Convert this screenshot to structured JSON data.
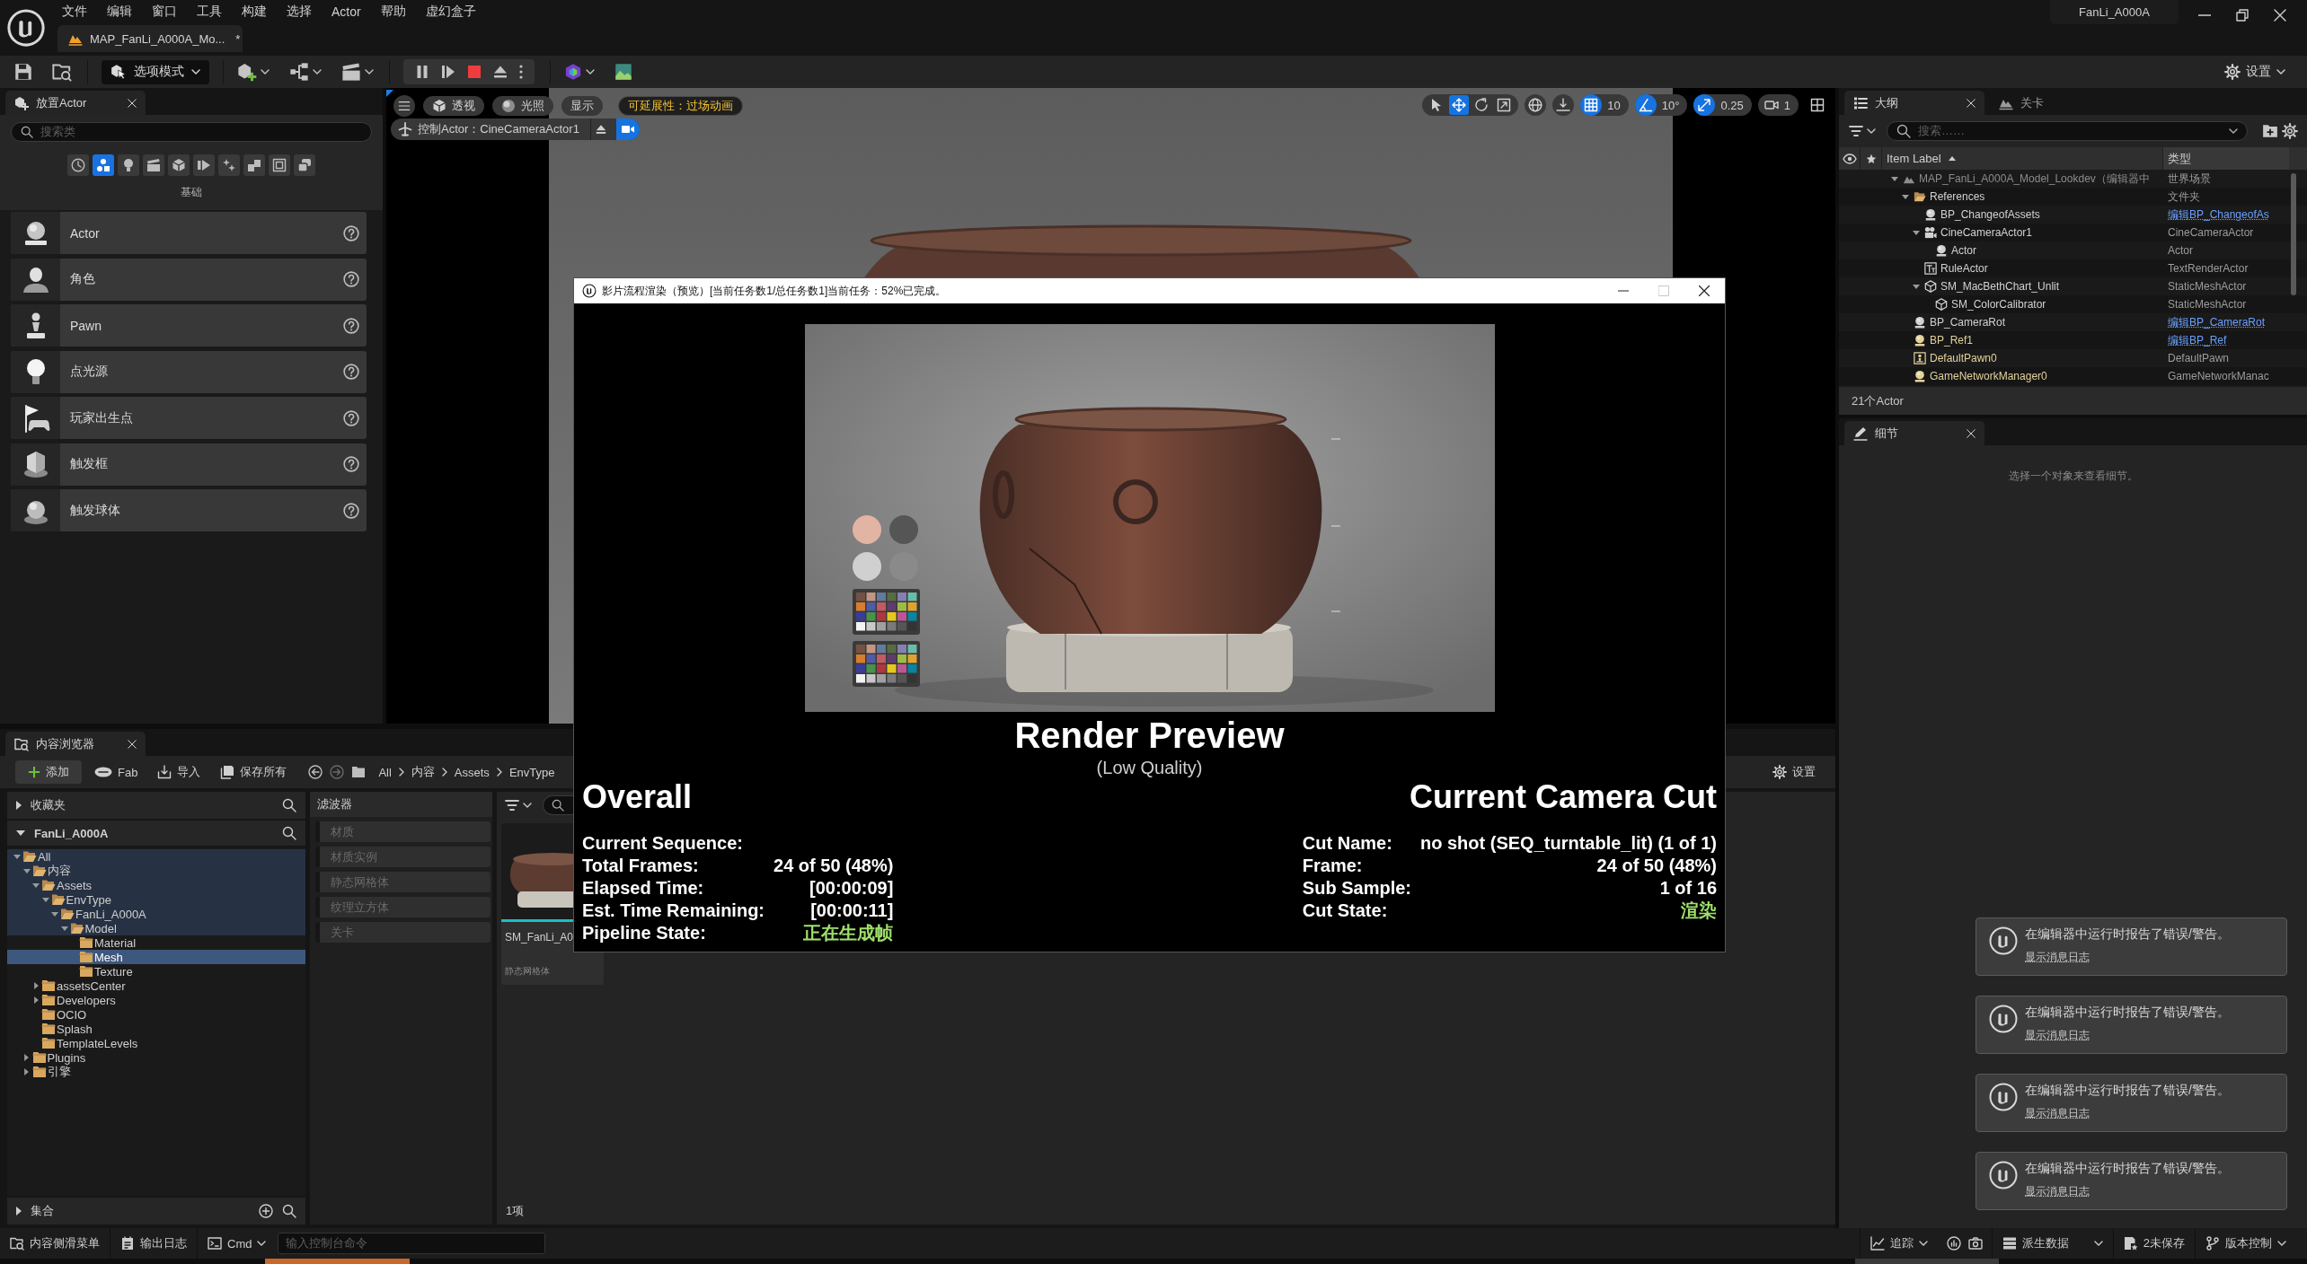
{
  "title_bar": {
    "menu": [
      "文件",
      "编辑",
      "窗口",
      "工具",
      "构建",
      "选择",
      "Actor",
      "帮助",
      "虚幻盒子"
    ],
    "document_tab": {
      "title": "MAP_FanLi_A000A_Mo...",
      "modified": "*"
    },
    "project": "FanLi_A000A"
  },
  "toolbar": {
    "mode": "选项模式",
    "settings": "设置"
  },
  "place_actors": {
    "tab": "放置Actor",
    "search": {
      "placeholder": "搜索类"
    },
    "categories": [
      {
        "kind": "recent",
        "selected": false
      },
      {
        "kind": "basic",
        "selected": true
      },
      {
        "kind": "lights",
        "selected": false
      },
      {
        "kind": "cinematic",
        "selected": false
      },
      {
        "kind": "visual",
        "selected": false
      },
      {
        "kind": "volumes",
        "selected": false
      },
      {
        "kind": "effects",
        "selected": false
      },
      {
        "kind": "shapes",
        "selected": false
      },
      {
        "kind": "frame",
        "selected": false
      },
      {
        "kind": "stack",
        "selected": false
      }
    ],
    "category_title": "基础",
    "items": [
      {
        "label": "Actor",
        "kind": "actor"
      },
      {
        "label": "角色",
        "kind": "character"
      },
      {
        "label": "Pawn",
        "kind": "pawn"
      },
      {
        "label": "点光源",
        "kind": "light"
      },
      {
        "label": "玩家出生点",
        "kind": "start"
      },
      {
        "label": "触发框",
        "kind": "box"
      },
      {
        "label": "触发球体",
        "kind": "sphere"
      }
    ]
  },
  "viewport": {
    "view_mode": "透视",
    "lighting": "光照",
    "show": "显示",
    "scalability": "可延展性：过场动画",
    "pilot": "控制Actor：CineCameraActor1",
    "camera_view": true,
    "transform_tools": [
      {
        "kind": "select",
        "selected": false
      },
      {
        "kind": "move",
        "selected": true
      },
      {
        "kind": "rotate",
        "selected": false
      },
      {
        "kind": "scale",
        "selected": false
      }
    ],
    "snaps": [
      {
        "kind": "grid",
        "value": "10",
        "on": true
      },
      {
        "kind": "angle",
        "value": "10°",
        "on": true
      },
      {
        "kind": "scale",
        "value": "0.25",
        "on": true
      }
    ],
    "camera_speed": "1"
  },
  "render_dialog": {
    "title": "影片流程渲染（预览）[当前任务数1/总任务数1]当前任务：52%已完成。",
    "heading": "Render Preview",
    "subheading": "(Low Quality)",
    "overall": {
      "title": "Overall",
      "stats": [
        {
          "label": "Current Sequence:"
        },
        {
          "label": "Total Frames:",
          "value": "24 of 50 (48%)",
          "color": "#ffffff"
        },
        {
          "label": "Elapsed Time:",
          "value": "[00:00:09]",
          "color": "#ffffff"
        },
        {
          "label": "Est. Time Remaining:",
          "value": "[00:00:11]",
          "color": "#ffffff"
        },
        {
          "label": "Pipeline State:",
          "value": "正在生成帧",
          "color": "#9fe06a"
        }
      ]
    },
    "camera_cut": {
      "title": "Current Camera Cut",
      "stats": [
        {
          "label": "Cut Name:",
          "value": "no shot (SEQ_turntable_lit) (1 of 1)",
          "color": "#ffffff"
        },
        {
          "label": "Frame:",
          "value": "24 of 50 (48%)",
          "color": "#ffffff"
        },
        {
          "label": "Sub Sample:",
          "value": "1 of 16",
          "color": "#ffffff"
        },
        {
          "label": "Cut State:",
          "value": "渲染",
          "color": "#9fe06a"
        }
      ]
    }
  },
  "outliner": {
    "tabs": [
      {
        "label": "大纲",
        "selected": true
      },
      {
        "label": "关卡",
        "selected": false
      }
    ],
    "search": {
      "placeholder": "搜索……"
    },
    "columns": [
      "Item Label",
      "类型"
    ],
    "rows": [
      {
        "label": "MAP_FanLi_A000A_Model_Lookdev（编辑器中",
        "kind": "world",
        "color": "#8c8c8c",
        "type": "世界场景",
        "type_link": false,
        "expanded": true,
        "children": [
          {
            "label": "References",
            "kind": "folder",
            "color": "#d2d2d2",
            "type": "文件夹",
            "type_link": false,
            "expanded": true,
            "children": [
              {
                "label": "BP_ChangeofAssets",
                "kind": "actor",
                "color": "#d2d2d2",
                "type": "编辑BP_ChangeofAs",
                "type_link": true
              },
              {
                "label": "CineCameraActor1",
                "kind": "camera",
                "color": "#d2d2d2",
                "type": "CineCameraActor",
                "type_link": false,
                "expanded": true,
                "children": [
                  {
                    "label": "Actor",
                    "kind": "actor",
                    "color": "#d2d2d2",
                    "type": "Actor",
                    "type_link": false
                  }
                ]
              },
              {
                "label": "RuleActor",
                "kind": "text",
                "color": "#d2d2d2",
                "type": "TextRenderActor",
                "type_link": false
              },
              {
                "label": "SM_MacBethChart_Unlit",
                "kind": "mesh",
                "color": "#d2d2d2",
                "type": "StaticMeshActor",
                "type_link": false,
                "expanded": true,
                "children": [
                  {
                    "label": "SM_ColorCalibrator",
                    "kind": "mesh",
                    "color": "#d2d2d2",
                    "type": "StaticMeshActor",
                    "type_link": false
                  }
                ]
              }
            ]
          },
          {
            "label": "BP_CameraRot",
            "kind": "actor",
            "color": "#d2d2d2",
            "type": "编辑BP_CameraRot",
            "type_link": true
          },
          {
            "label": "BP_Ref1",
            "kind": "actor",
            "color": "#e3d29c",
            "type": "编辑BP_Ref",
            "type_link": true
          },
          {
            "label": "DefaultPawn0",
            "kind": "pawn",
            "color": "#e3d29c",
            "type": "DefaultPawn",
            "type_link": false
          },
          {
            "label": "GameNetworkManager0",
            "kind": "actor",
            "color": "#e3d29c",
            "type": "GameNetworkManac",
            "type_link": false
          }
        ]
      }
    ],
    "footer": "21个Actor"
  },
  "details": {
    "tab": "细节",
    "message": "选择一个对象来查看细节。"
  },
  "content_browser": {
    "tab": "内容浏览器",
    "add": "添加",
    "fab": "Fab",
    "import": "导入",
    "save_all": "保存所有",
    "breadcrumb": [
      "All",
      "内容",
      "Assets",
      "EnvType"
    ],
    "settings": "设置",
    "favorites": {
      "label": "收藏夹",
      "expanded": false
    },
    "project": {
      "label": "FanLi_A000A",
      "expanded": true
    },
    "tree": [
      {
        "label": "All",
        "expanded": true,
        "selected": false,
        "children": [
          {
            "label": "内容",
            "expanded": true,
            "selected": false,
            "children": [
              {
                "label": "Assets",
                "expanded": true,
                "selected": false,
                "children": [
                  {
                    "label": "EnvType",
                    "expanded": true,
                    "selected": false,
                    "children": [
                      {
                        "label": "FanLi_A000A",
                        "expanded": true,
                        "selected": false,
                        "children": [
                          {
                            "label": "Model",
                            "expanded": true,
                            "selected": false,
                            "children": [
                              {
                                "label": "Material",
                                "selected": false
                              },
                              {
                                "label": "Mesh",
                                "selected": true
                              },
                              {
                                "label": "Texture",
                                "selected": false
                              }
                            ]
                          }
                        ]
                      }
                    ]
                  }
                ]
              },
              {
                "label": "assetsCenter",
                "expanded": false,
                "selected": false
              },
              {
                "label": "Developers",
                "expanded": false,
                "selected": false
              },
              {
                "label": "OCIO",
                "selected": false
              },
              {
                "label": "Splash",
                "selected": false
              },
              {
                "label": "TemplateLevels",
                "selected": false
              }
            ]
          },
          {
            "label": "Plugins",
            "expanded": false,
            "selected": false
          },
          {
            "label": "引擎",
            "expanded": false,
            "selected": false
          }
        ]
      }
    ],
    "collections": {
      "label": "集合",
      "expanded": false
    },
    "filters_title": "滤波器",
    "filters": [
      {
        "label": "材质",
        "checked": false
      },
      {
        "label": "材质实例",
        "checked": false
      },
      {
        "label": "静态网格体",
        "checked": false
      },
      {
        "label": "纹理立方体",
        "checked": false
      },
      {
        "label": "关卡",
        "checked": false
      }
    ],
    "asset": {
      "name": "SM_FanLi_A0",
      "type": "静态网格体"
    },
    "count": "1项"
  },
  "status_bar": {
    "content_drawer": "内容侧滑菜单",
    "output_log": "输出日志",
    "cmd": "Cmd",
    "console": {
      "placeholder": "输入控制台命令"
    },
    "trace": "追踪",
    "derived_data": "派生数据",
    "unsaved": "2未保存",
    "source_control": "版本控制"
  },
  "notifications": [
    {
      "message": "在编辑器中运行时报告了错误/警告。",
      "link": "显示消息日志"
    },
    {
      "message": "在编辑器中运行时报告了错误/警告。",
      "link": "显示消息日志"
    },
    {
      "message": "在编辑器中运行时报告了错误/警告。",
      "link": "显示消息日志"
    },
    {
      "message": "在编辑器中运行时报告了错误/警告。",
      "link": "显示消息日志"
    }
  ]
}
